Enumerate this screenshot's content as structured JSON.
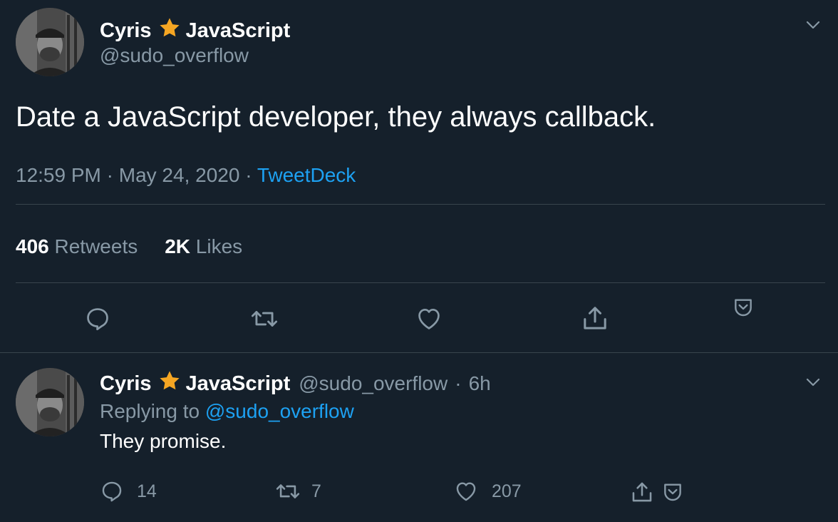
{
  "tweet": {
    "author": {
      "name": "Cyris",
      "badge_icon": "star-icon",
      "badge_color": "#f5a623",
      "name_suffix": "JavaScript",
      "handle": "@sudo_overflow"
    },
    "text": "Date a JavaScript developer, they always callback.",
    "time": "12:59 PM",
    "date": "May 24, 2020",
    "separator": "·",
    "source": "TweetDeck",
    "stats": {
      "retweets_count": "406",
      "retweets_label": "Retweets",
      "likes_count": "2K",
      "likes_label": "Likes"
    },
    "actions": [
      "reply-icon",
      "retweet-icon",
      "like-icon",
      "share-icon",
      "bookmark-icon"
    ]
  },
  "reply": {
    "author": {
      "name": "Cyris",
      "name_suffix": "JavaScript",
      "handle": "@sudo_overflow",
      "age": "6h"
    },
    "replying_label": "Replying to",
    "replying_to": "@sudo_overflow",
    "text": "They promise.",
    "counts": {
      "replies": "14",
      "retweets": "7",
      "likes": "207"
    }
  },
  "colors": {
    "background": "#15202b",
    "text": "#ffffff",
    "muted": "#8899a6",
    "link": "#1da1f2",
    "divider": "#38444d"
  }
}
